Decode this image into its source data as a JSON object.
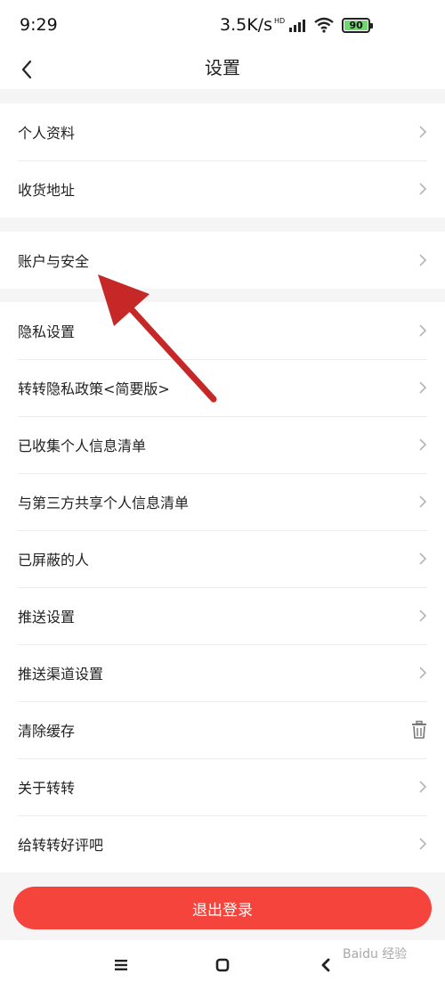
{
  "status_bar": {
    "time": "9:29",
    "network_speed": "3.5K/s",
    "hd": "HD",
    "battery": "90",
    "icons": [
      "signal-icon",
      "wifi-icon",
      "battery-icon"
    ]
  },
  "nav": {
    "title": "设置",
    "back_icon": "chevron-left-icon"
  },
  "groups": [
    {
      "items": [
        "个人资料",
        "收货地址"
      ]
    },
    {
      "items": [
        "账户与安全"
      ]
    },
    {
      "items": [
        "隐私设置",
        "转转隐私政策<简要版>",
        "已收集个人信息清单",
        "与第三方共享个人信息清单",
        "已屏蔽的人",
        "推送设置",
        "推送渠道设置",
        "清除缓存",
        "关于转转",
        "给转转好评吧"
      ]
    }
  ],
  "logout_label": "退出登录",
  "system_nav": [
    "menu-icon",
    "home-icon",
    "back-icon"
  ],
  "watermark": "Baidu 经验",
  "colors": {
    "accent": "#f4443c",
    "annotation_arrow": "#c62828",
    "background": "#f5f5f5"
  }
}
